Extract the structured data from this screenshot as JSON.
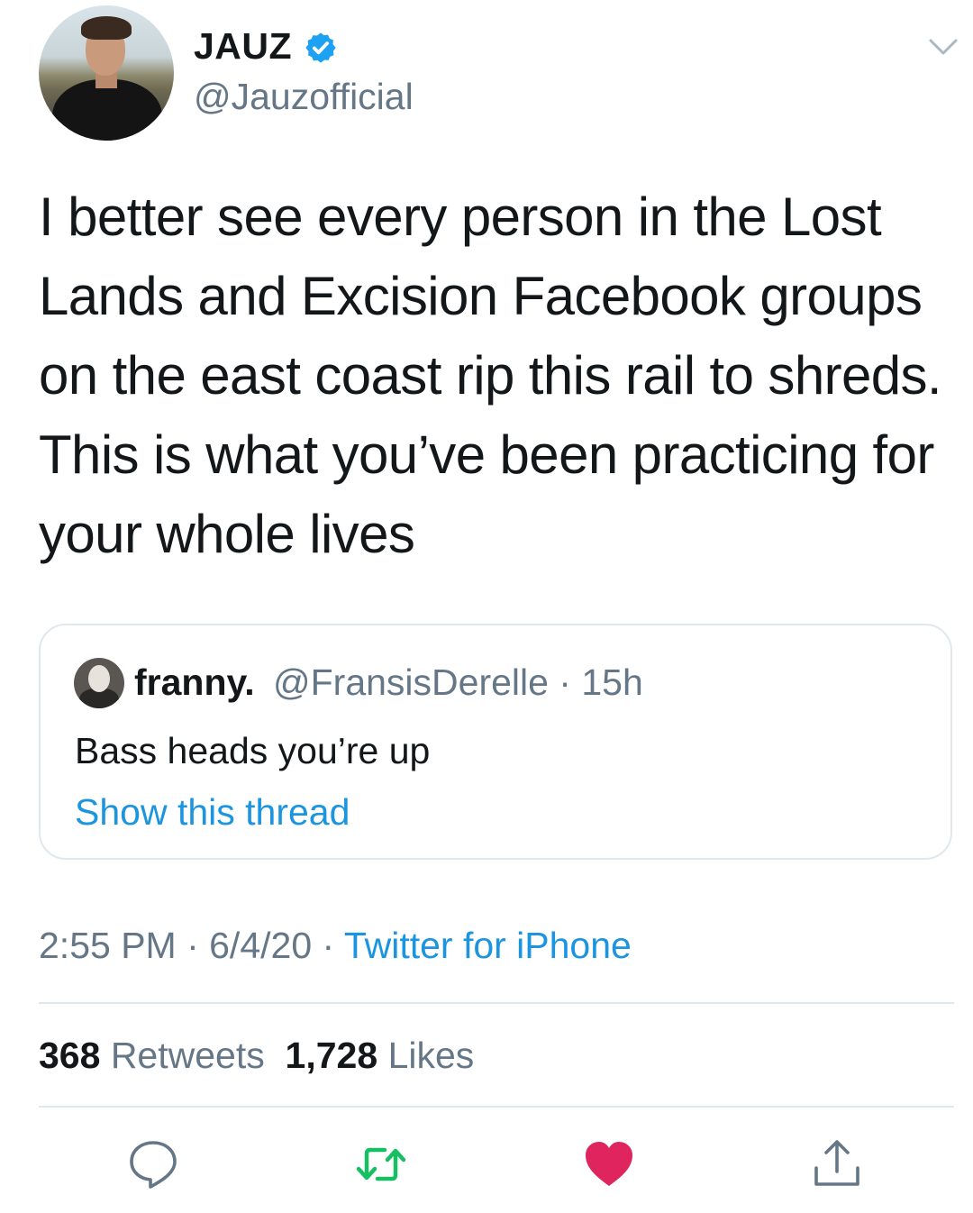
{
  "author": {
    "name": "JAUZ",
    "handle": "@Jauzofficial",
    "verified": true
  },
  "tweet": {
    "text": "I better see every person in the Lost Lands and Excision Facebook groups on the east coast rip this rail to shreds. This is what you’ve been practicing for your whole lives"
  },
  "quoted_tweet": {
    "name": "franny.",
    "handle_time": "@FransisDerelle · 15h",
    "text": "Bass heads you’re up",
    "thread_link": "Show this thread"
  },
  "meta": {
    "time_date": "2:55 PM · 6/4/20 · ",
    "source": "Twitter for iPhone"
  },
  "stats": {
    "retweets_count": "368",
    "retweets_label": "Retweets",
    "likes_count": "1,728",
    "likes_label": "Likes"
  },
  "actions": {
    "reply_icon": "reply-icon",
    "retweet_icon": "retweet-icon",
    "like_icon": "heart-icon",
    "share_icon": "share-icon"
  },
  "colors": {
    "link": "#1b95e0",
    "secondary_text": "#657786",
    "retweet_green": "#17bf63",
    "like_red": "#e0245e",
    "verified_blue": "#1da1f2"
  }
}
